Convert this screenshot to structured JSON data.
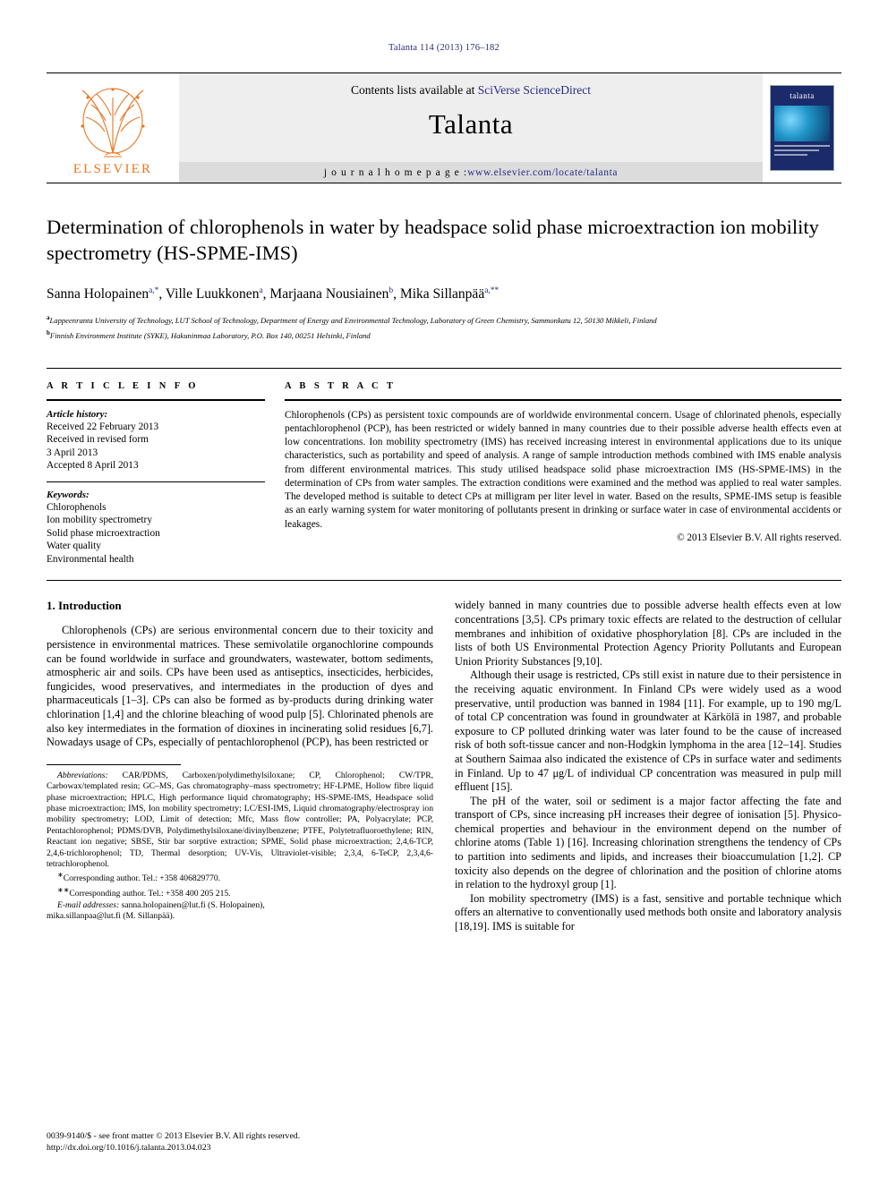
{
  "running_head": "Talanta 114 (2013) 176–182",
  "masthead": {
    "contents_prefix": "Contents lists available at ",
    "contents_link": "SciVerse ScienceDirect",
    "journal_name": "Talanta",
    "homepage_label": "j o u r n a l   h o m e p a g e :  ",
    "homepage_url": "www.elsevier.com/locate/talanta",
    "publisher_logo_text": "ELSEVIER",
    "cover_title": "talanta"
  },
  "article": {
    "title": "Determination of chlorophenols in water by headspace solid phase microextraction ion mobility spectrometry (HS-SPME-IMS)",
    "authors": [
      {
        "name": "Sanna Holopainen",
        "marks": "a,*"
      },
      {
        "name": "Ville Luukkonen",
        "marks": "a"
      },
      {
        "name": "Marjaana Nousiainen",
        "marks": "b"
      },
      {
        "name": "Mika Sillanpää",
        "marks": "a,**"
      }
    ],
    "affiliations": [
      {
        "mark": "a",
        "text": "Lappeenranta University of Technology, LUT School of Technology, Department of Energy and Environmental Technology, Laboratory of Green Chemistry, Sammonkatu 12, 50130 Mikkeli, Finland"
      },
      {
        "mark": "b",
        "text": "Finnish Environment Institute (SYKE), Hakuninmaa Laboratory, P.O. Box 140, 00251 Helsinki, Finland"
      }
    ]
  },
  "article_info": {
    "heading": "A R T I C L E   I N F O",
    "history_label": "Article history:",
    "history": [
      "Received 22 February 2013",
      "Received in revised form",
      "3 April 2013",
      "Accepted 8 April 2013"
    ],
    "keywords_label": "Keywords:",
    "keywords": [
      "Chlorophenols",
      "Ion mobility spectrometry",
      "Solid phase microextraction",
      "Water quality",
      "Environmental health"
    ]
  },
  "abstract": {
    "heading": "A B S T R A C T",
    "text": "Chlorophenols (CPs) as persistent toxic compounds are of worldwide environmental concern. Usage of chlorinated phenols, especially pentachlorophenol (PCP), has been restricted or widely banned in many countries due to their possible adverse health effects even at low concentrations. Ion mobility spectrometry (IMS) has received increasing interest in environmental applications due to its unique characteristics, such as portability and speed of analysis. A range of sample introduction methods combined with IMS enable analysis from different environmental matrices. This study utilised headspace solid phase microextraction IMS (HS-SPME-IMS) in the determination of CPs from water samples. The extraction conditions were examined and the method was applied to real water samples. The developed method is suitable to detect CPs at milligram per liter level in water. Based on the results, SPME-IMS setup is feasible as an early warning system for water monitoring of pollutants present in drinking or surface water in case of environmental accidents or leakages.",
    "copyright": "© 2013 Elsevier B.V. All rights reserved."
  },
  "introduction": {
    "heading": "1.  Introduction",
    "left_paragraphs": [
      "Chlorophenols (CPs) are serious environmental concern due to their toxicity and persistence in environmental matrices. These semivolatile organochlorine compounds can be found worldwide in surface and groundwaters, wastewater, bottom sediments, atmospheric air and soils. CPs have been used as antiseptics, insecticides, herbicides, fungicides, wood preservatives, and intermediates in the production of dyes and pharmaceuticals [1–3]. CPs can also be formed as by-products during drinking water chlorination [1,4] and the chlorine bleaching of wood pulp [5]. Chlorinated phenols are also key intermediates in the formation of dioxines in incinerating solid residues [6,7]. Nowadays usage of CPs, especially of pentachlorophenol (PCP), has been restricted or"
    ],
    "right_paragraphs": [
      "widely banned in many countries due to possible adverse health effects even at low concentrations [3,5]. CPs primary toxic effects are related to the destruction of cellular membranes and inhibition of oxidative phosphorylation [8]. CPs are included in the lists of both US Environmental Protection Agency Priority Pollutants and European Union Priority Substances [9,10].",
      "Although their usage is restricted, CPs still exist in nature due to their persistence in the receiving aquatic environment. In Finland CPs were widely used as a wood preservative, until production was banned in 1984 [11]. For example, up to 190 mg/L of total CP concentration was found in groundwater at Kärkölä in 1987, and probable exposure to CP polluted drinking water was later found to be the cause of increased risk of both soft-tissue cancer and non-Hodgkin lymphoma in the area [12–14]. Studies at Southern Saimaa also indicated the existence of CPs in surface water and sediments in Finland. Up to 47 μg/L of individual CP concentration was measured in pulp mill effluent [15].",
      "The pH of the water, soil or sediment is a major factor affecting the fate and transport of CPs, since increasing pH increases their degree of ionisation [5]. Physico-chemical properties and behaviour in the environment depend on the number of chlorine atoms (Table 1) [16]. Increasing chlorination strengthens the tendency of CPs to partition into sediments and lipids, and increases their bioaccumulation [1,2]. CP toxicity also depends on the degree of chlorination and the position of chlorine atoms in relation to the hydroxyl group [1].",
      "Ion mobility spectrometry (IMS) is a fast, sensitive and portable technique which offers an alternative to conventionally used methods both onsite and laboratory analysis [18,19]. IMS is suitable for"
    ]
  },
  "footnotes": {
    "abbreviations_label": "Abbreviations:",
    "abbreviations_text": " CAR/PDMS, Carboxen/polydimethylsiloxane; CP, Chlorophenol; CW/TPR, Carbowax/templated resin; GC–MS, Gas chromatography–mass spectrometry; HF-LPME, Hollow fibre liquid phase microextraction; HPLC, High performance liquid chromatography; HS-SPME-IMS, Headspace solid phase microextraction; IMS, Ion mobility spectrometry; LC/ESI-IMS, Liquid chromatography/electrospray ion mobility spectrometry; LOD, Limit of detection; Mfc, Mass flow controller; PA, Polyacrylate; PCP, Pentachlorophenol; PDMS/DVB, Polydimethylsiloxane/divinylbenzene; PTFE, Polytetrafluoroethylene; RIN, Reactant ion negative; SBSE, Stir bar sorptive extraction; SPME, Solid phase microextraction; 2,4,6-TCP, 2,4,6-trichlorophenol; TD, Thermal desorption; UV-Vis, Ultraviolet-visible; 2,3,4, 6-TeCP, 2,3,4,6-tetrachlorophenol.",
    "corresponding_1": "Corresponding author. Tel.: +358 406829770.",
    "corresponding_2": "Corresponding author. Tel.: +358 400 205 215.",
    "email_label": "E-mail addresses:",
    "email_1": " sanna.holopainen@lut.fi (S. Holopainen),",
    "email_2": "mika.sillanpaa@lut.fi (M. Sillanpää)."
  },
  "page_footer": {
    "issn_line": "0039-9140/$ - see front matter © 2013 Elsevier B.V. All rights reserved.",
    "doi": "http://dx.doi.org/10.1016/j.talanta.2013.04.023"
  }
}
